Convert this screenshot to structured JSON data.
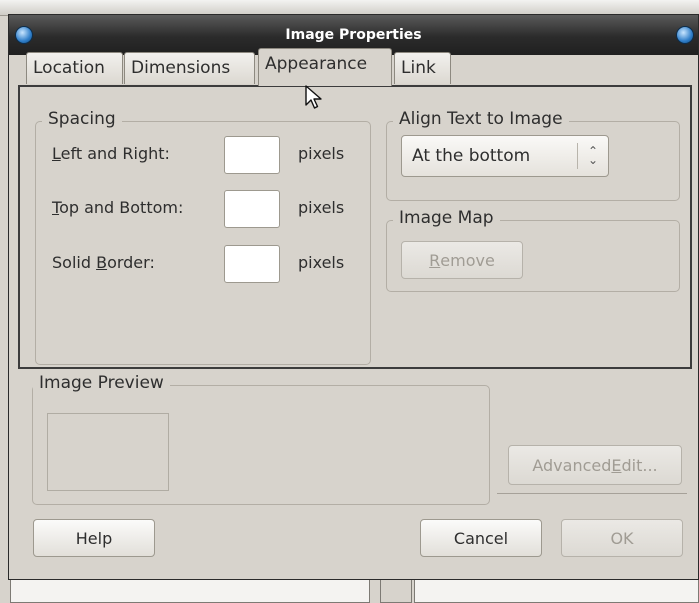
{
  "window": {
    "title": "Image Properties"
  },
  "tabs": [
    {
      "label": "Location",
      "active": false
    },
    {
      "label": "Dimensions",
      "active": false
    },
    {
      "label": "Appearance",
      "active": true
    },
    {
      "label": "Link",
      "active": false
    }
  ],
  "spacing": {
    "title": "Spacing",
    "left_right": {
      "label_pre": "",
      "mnemonic": "L",
      "label_post": "eft and Right:",
      "value": "",
      "unit": "pixels"
    },
    "top_bottom": {
      "label_pre": "",
      "mnemonic": "T",
      "label_post": "op and Bottom:",
      "value": "",
      "unit": "pixels"
    },
    "solid_border": {
      "label_pre": "Solid ",
      "mnemonic": "B",
      "label_post": "order:",
      "value": "",
      "unit": "pixels"
    }
  },
  "align": {
    "title": "Align Text to Image",
    "selected": "At the bottom"
  },
  "image_map": {
    "title": "Image Map",
    "remove_pre": "",
    "remove_mnemonic": "R",
    "remove_post": "emove"
  },
  "preview": {
    "title": "Image Preview"
  },
  "advanced_edit": {
    "pre": "Advanced ",
    "mnemonic": "E",
    "post": "dit..."
  },
  "buttons": {
    "help": "Help",
    "cancel": "Cancel",
    "ok": "OK"
  },
  "icons": {
    "window_orb_left": "window-menu-orb-icon",
    "window_orb_right": "window-close-orb-icon",
    "select_arrows": "up-down-arrows-icon",
    "cursor": "mouse-pointer-icon"
  }
}
